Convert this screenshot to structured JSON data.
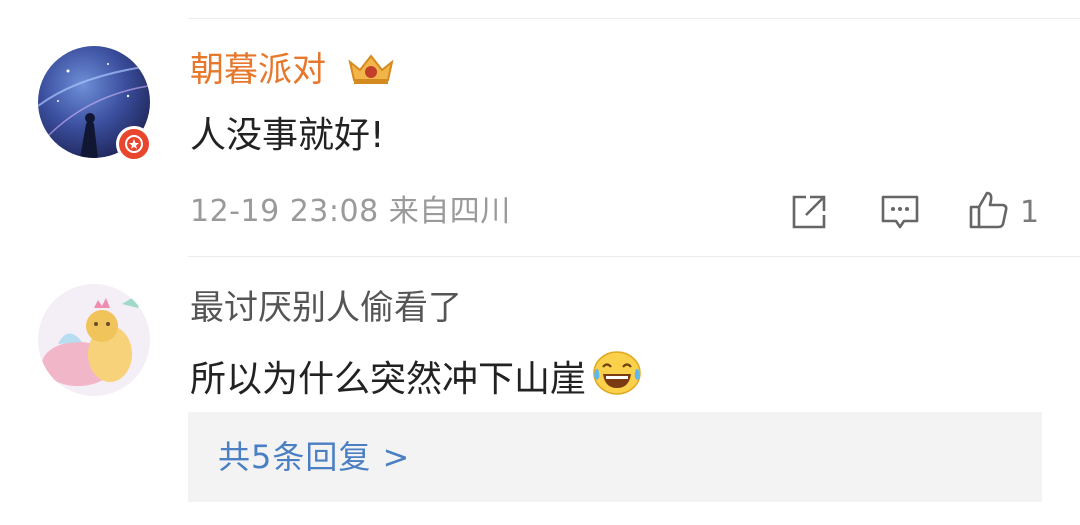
{
  "comment1": {
    "username": "朝暮派对",
    "text": "人没事就好!",
    "meta": "12-19 23:08 来自四川",
    "likes": "1",
    "username_color": "#e7772b",
    "badge_color": "#e8462e",
    "actions": [
      "share-icon",
      "comment-icon",
      "like-icon"
    ]
  },
  "comment2": {
    "username": "最讨厌别人偷看了",
    "text": "所以为什么突然冲下山崖",
    "emoji": "laughing-tears-emoji",
    "reply_link": "共5条回复 >",
    "link_color": "#4b7fc4"
  }
}
